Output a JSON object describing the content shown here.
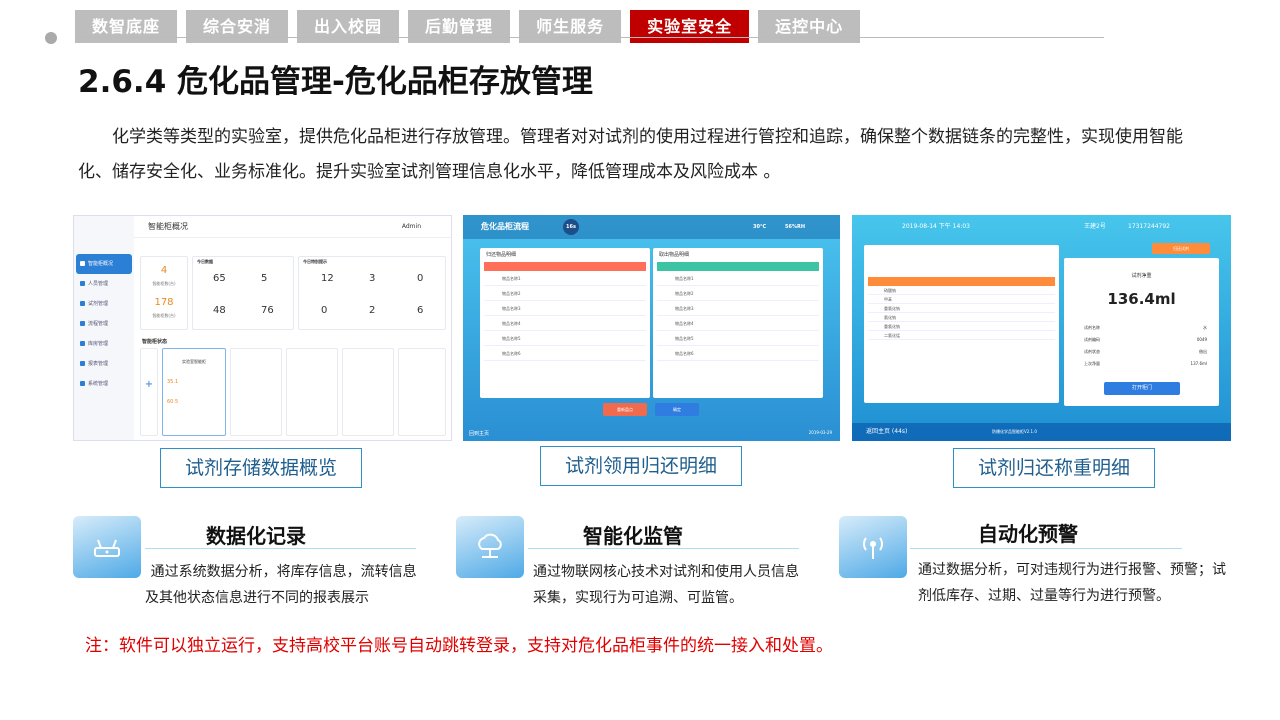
{
  "tabs": [
    {
      "label": "数智底座",
      "active": false
    },
    {
      "label": "综合安消",
      "active": false
    },
    {
      "label": "出入校园",
      "active": false
    },
    {
      "label": "后勤管理",
      "active": false
    },
    {
      "label": "师生服务",
      "active": false
    },
    {
      "label": "实验室安全",
      "active": true
    },
    {
      "label": "运控中心",
      "active": false
    }
  ],
  "title": "2.6.4 危化品管理-危化品柜存放管理",
  "intro": "化学类等类型的实验室，提供危化品柜进行存放管理。管理者对对试剂的使用过程进行管控和追踪，确保整个数据链条的完整性，实现使用智能化、储存安全化、业务标准化。提升实验室试剂管理信息化水平，降低管理成本及风险成本 。",
  "screens": {
    "s1": {
      "header": "智能柜概况",
      "admin": "Admin",
      "menu": [
        "智能柜概况",
        "人员管理",
        "试剂管理",
        "流程管理",
        "库房管理",
        "报表管理",
        "系统管理"
      ],
      "stat1": {
        "value": "4",
        "label": "智能柜数(台)"
      },
      "stat2": {
        "value": "178",
        "label": "智能柜数(台)"
      },
      "today": {
        "title": "今日数据",
        "a": "65",
        "b": "5",
        "c": "48",
        "d": "76"
      },
      "alarm": {
        "title": "今日特别提示",
        "a": "12",
        "b": "3",
        "c": "0",
        "d": "0",
        "e": "2",
        "f": "6"
      },
      "status_title": "智能柜状态",
      "cabinet_name": "实验室智能柜",
      "temp": "35.1",
      "hum": "60.5"
    },
    "s2": {
      "header": "危化品柜流程",
      "timer": "16s",
      "weather": "30°C",
      "humidity": "56%RH",
      "left_title": "归还物品明细",
      "right_title": "取出物品明细",
      "rows": [
        [
          "物品名称1",
          "BM20190320001",
          "23.5Kg",
          "备注文字信息1"
        ],
        [
          "物品名称2",
          "BM20190320002",
          "28.6Kg",
          "备注文字信息2"
        ],
        [
          "物品名称3",
          "BM20190320003",
          "24.5Kg",
          "备注文字信息3"
        ],
        [
          "物品名称4",
          "BM20190320004",
          "13.2Kg",
          "备注文字信息4"
        ],
        [
          "物品名称5",
          "BM20190320005",
          "28.6Kg",
          "备注文字信息5"
        ],
        [
          "物品名称6",
          "BM20190320006",
          "24.5Kg",
          "备注文字信息6"
        ]
      ],
      "btn_cancel": "重新盘点",
      "btn_ok": "确定",
      "back": "回到主页",
      "date": "2019-03-29"
    },
    "s3": {
      "datetime": "2019-08-14 下午 14:03",
      "user": "王建2号",
      "phone": "17317244792",
      "weight_label": "试剂净重",
      "weight": "136.4ml",
      "info": [
        [
          "试剂名称",
          "水"
        ],
        [
          "试剂编码",
          "0049"
        ],
        [
          "试剂状态",
          "借出"
        ],
        [
          "上次净量",
          "137.6ml"
        ]
      ],
      "open_btn": "打开柜门",
      "return_btn": "归还试剂",
      "back": "返回主页 (44s)",
      "footer": "防爆化学品智能柜V2.1.0",
      "rows": [
        [
          "硝酸钠",
          "10022-31-8",
          "174.5g/3瓶"
        ],
        [
          "甲苯",
          "108-88-3",
          "123.1ml/3瓶"
        ],
        [
          "重氯化钠",
          "1305-60-6",
          "78.2g/3瓶"
        ],
        [
          "氯化钠",
          "1305-78-8",
          "14.3g/2瓶"
        ],
        [
          "重氯化钠",
          "1310-73-2",
          "194.2g/4瓶"
        ],
        [
          "二氯化锰",
          "1313-13-9",
          "316.0g/5瓶"
        ]
      ]
    }
  },
  "captions": [
    "试剂存储数据概览",
    "试剂领用归还明细",
    "试剂归还称重明细"
  ],
  "features": [
    {
      "title": "数据化记录",
      "desc": "通过系统数据分析，将库存信息，流转信息及其他状态信息进行不同的报表展示",
      "icon": "router-icon"
    },
    {
      "title": "智能化监管",
      "desc": "通过物联网核心技术对试剂和使用人员信息采集，实现行为可追溯、可监管。",
      "icon": "network-cloud-icon"
    },
    {
      "title": "自动化预警",
      "desc": "通过数据分析，可对违规行为进行报警、预警；试剂低库存、过期、过量等行为进行预警。",
      "icon": "signal-tower-icon"
    }
  ],
  "note": "注：软件可以独立运行，支持高校平台账号自动跳转登录，支持对危化品柜事件的统一接入和处置。",
  "colors": {
    "active_tab": "#c00000",
    "tab": "#bdbdbd",
    "caption_border": "#2f8fc9",
    "note": "#e00000"
  }
}
